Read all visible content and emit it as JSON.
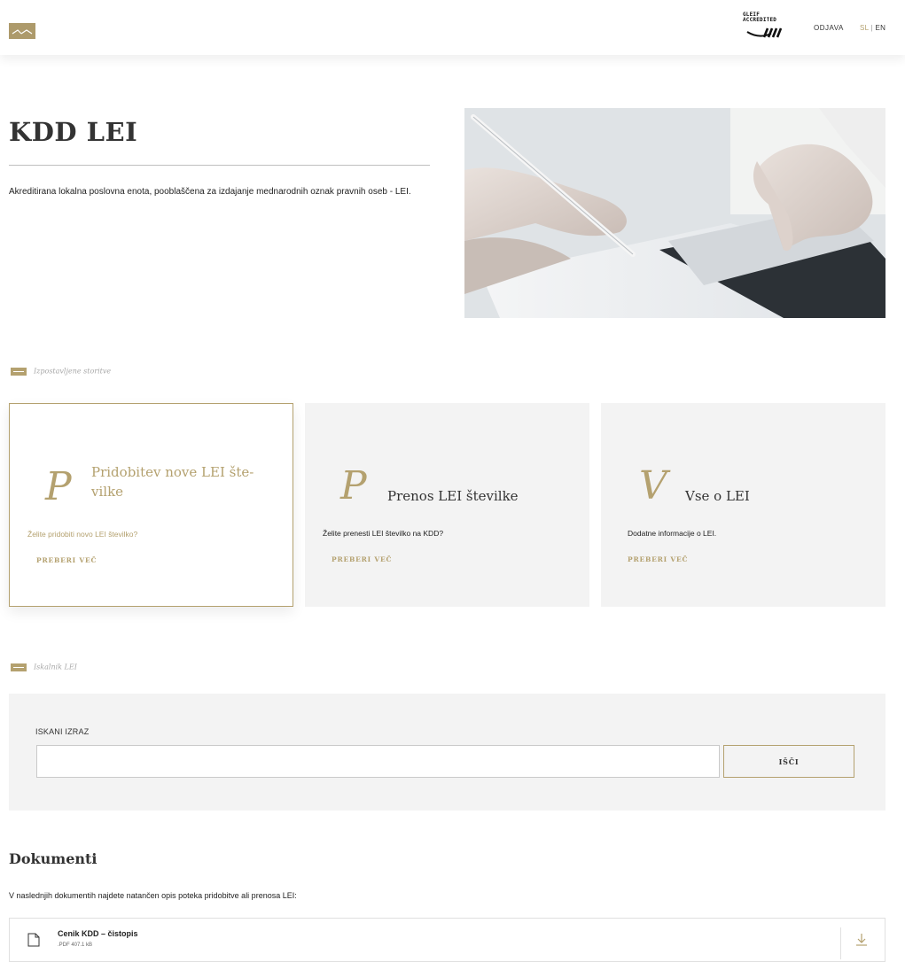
{
  "header": {
    "logo_icon": "kdd-logo-icon",
    "partner_logo_lines": [
      "GLEIF",
      "ACCREDITED"
    ],
    "login_label": "ODJAVA",
    "lang_sl": "SL",
    "lang_separator": "|",
    "lang_en": "EN"
  },
  "hero": {
    "title": "KDD LEI",
    "description": "Akreditirana lokalna poslovna enota, pooblaščena za izdajanje mednarodnih oznak pravnih oseb - LEI.",
    "image": "hand-signing-document-photo"
  },
  "services": {
    "section_label": "Izpostavljene storitve",
    "cards": [
      {
        "letter": "P",
        "title": "Pridobitev nove LEI šte-vilke",
        "description": "Želite pridobiti novo LEI številko?",
        "more": "PREBERI VEČ"
      },
      {
        "letter": "P",
        "title": "Prenos LEI številke",
        "description": "Želite prenesti LEI številko na KDD?",
        "more": "PREBERI VEČ"
      },
      {
        "letter": "V",
        "title": "Vse o LEI",
        "description": "Dodatne informacije o LEI.",
        "more": "PREBERI VEČ"
      }
    ]
  },
  "search": {
    "section_label": "Iskalnik LEI",
    "field_label": "ISKANI IZRAZ",
    "input_value": "",
    "input_placeholder": "",
    "button_label": "IŠČI"
  },
  "documents": {
    "title": "Dokumenti",
    "description": "V naslednjih dokumentih najdete natančen opis poteka pridobitve ali prenosa LEI:",
    "items": [
      {
        "name": "Cenik KDD – čistopis",
        "meta": ".PDF 407.1 kB",
        "icon": "document-icon",
        "action_icon": "download-icon"
      }
    ]
  },
  "colors": {
    "accent": "#b4a16f",
    "panel": "#f3f3f3",
    "text": "#222222"
  }
}
